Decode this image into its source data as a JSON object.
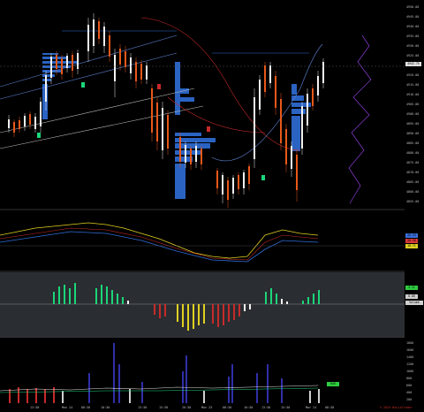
{
  "header": {
    "line1": "Order Flow Volume Profile, Order Flow Volume Profile, smaTrendaccBlanke(21 50 13 Minute), ivCSWI_Time_Range 1 0 D/1.0.6.1 (94.6%b) Color(1,0)",
    "line2": "1/3/2024 12:00:00 - 1/25/2024 04:15:00",
    "line3": "ESH4 1 Minute"
  },
  "price_axis": {
    "labels": [
      "4950.00",
      "4945.00",
      "4940.00",
      "4935.00",
      "4930.00",
      "4925.00",
      "4920.00",
      "4915.00",
      "4910.00",
      "4905.00",
      "4900.00",
      "4895.00",
      "4890.00",
      "4885.00",
      "4880.00",
      "4875.00",
      "4870.00",
      "4865.00",
      "4860.00",
      "4855.00"
    ],
    "current_price": "4942.75"
  },
  "panel2": {
    "title": "ahas1b9(IJ0 50 50 Minute) 0.0 55(14 0 20.000.1.0) (TEST 11)",
    "tags": [
      {
        "text": "26.34",
        "color": "#3a6fd8"
      },
      {
        "text": "20.38",
        "color": "#d83a3a"
      },
      {
        "text": "18.71",
        "color": "#e0d020"
      }
    ]
  },
  "panel3": {
    "title": "ULT_Oscillator_Oscillation",
    "tags": [
      {
        "text": "4.11",
        "color": "#2ecc40"
      },
      {
        "text": "0.00",
        "color": "#cfcfcf"
      },
      {
        "text": "Volume Osc.",
        "color": "#cfcfcf"
      }
    ]
  },
  "panel4": {
    "title": "smaRelativeVolume(21 50 10 1 Minute) 94_Close 40.00 (1.0.2)",
    "tags": [
      {
        "text": "1380",
        "color": "#3a6fd8"
      },
      {
        "text": "1060",
        "color": "#cfcfcf"
      },
      {
        "text": "846",
        "color": "#2ecc40"
      }
    ],
    "axis": [
      "1800",
      "1600",
      "1400",
      "1200",
      "1000",
      "800",
      "600",
      "400",
      "200"
    ]
  },
  "time_axis": [
    "13:30",
    "Mon 24",
    "08:30",
    "10:30",
    "13:30",
    "15:30",
    "20:30",
    "Mon 25",
    "08:30",
    "10:30",
    "13:30",
    "15:30",
    "Mar 24",
    "08:30"
  ],
  "footer": "© 2024 NinjaTrader",
  "colors": {
    "up": "#f2f2f2",
    "down": "#e9581a",
    "profile": "#2f6ed8",
    "signal": "#1bd67a"
  }
}
